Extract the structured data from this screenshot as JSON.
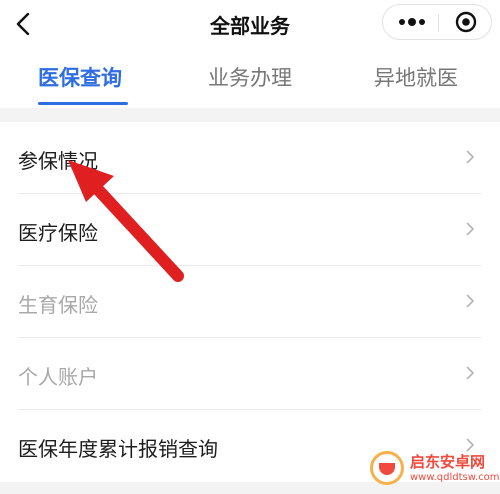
{
  "header": {
    "title": "全部业务",
    "back_icon": "chevron-left-icon",
    "more_icon": "more-dots-icon",
    "close_icon": "target-close-icon"
  },
  "tabs": [
    {
      "label": "医保查询",
      "active": true
    },
    {
      "label": "业务办理",
      "active": false
    },
    {
      "label": "异地就医",
      "active": false
    }
  ],
  "list": {
    "items": [
      {
        "label": "参保情况",
        "disabled": false
      },
      {
        "label": "医疗保险",
        "disabled": false
      },
      {
        "label": "生育保险",
        "disabled": true
      },
      {
        "label": "个人账户",
        "disabled": true
      },
      {
        "label": "医保年度累计报销查询",
        "disabled": false
      }
    ],
    "chevron_icon": "chevron-right-icon"
  },
  "annotation": {
    "type": "red-arrow",
    "color": "#e02020",
    "points_to": "参保情况"
  },
  "watermark": {
    "title": "启东安卓网",
    "url": "www.qdldtsw.com"
  },
  "colors": {
    "accent": "#2f6ee2",
    "arrow": "#e02020",
    "disabled_text": "#a8a8a8"
  }
}
